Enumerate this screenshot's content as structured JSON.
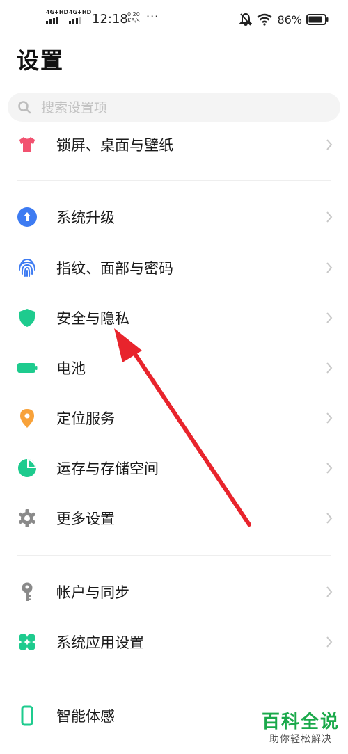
{
  "status_bar": {
    "sim1": "4G+HD",
    "sim2": "4G+HD",
    "time": "12:18",
    "speed_value": "0.20",
    "speed_unit": "KB/s",
    "more": "···",
    "battery": "86%",
    "battery_level": 0.86,
    "icons": [
      "signal-icon",
      "signal-icon",
      "mute-bell-icon",
      "wifi-icon",
      "battery-icon"
    ]
  },
  "header": {
    "title": "设置"
  },
  "search": {
    "placeholder": "搜索设置项",
    "value": ""
  },
  "groups": [
    {
      "items": [
        {
          "label": "锁屏、桌面与壁纸",
          "icon": "tshirt-icon",
          "color": "#f25270"
        }
      ]
    },
    {
      "items": [
        {
          "label": "系统升级",
          "icon": "upgrade-arrow-icon",
          "color": "#3d7bf2"
        },
        {
          "label": "指纹、面部与密码",
          "icon": "fingerprint-icon",
          "color": "#3d7bf2"
        },
        {
          "label": "安全与隐私",
          "icon": "shield-icon",
          "color": "#1ecb8e"
        },
        {
          "label": "电池",
          "icon": "battery-icon",
          "color": "#1ecb8e"
        },
        {
          "label": "定位服务",
          "icon": "location-pin-icon",
          "color": "#f8a23a"
        },
        {
          "label": "运存与存储空间",
          "icon": "pie-chart-icon",
          "color": "#1ecb8e"
        },
        {
          "label": "更多设置",
          "icon": "gear-icon",
          "color": "#8a8a8a"
        }
      ]
    },
    {
      "items": [
        {
          "label": "帐户与同步",
          "icon": "key-icon",
          "color": "#8a8a8a"
        },
        {
          "label": "系统应用设置",
          "icon": "apps-grid-icon",
          "color": "#1ecb8e"
        }
      ]
    },
    {
      "items": [
        {
          "label": "智能体感",
          "icon": "phone-outline-icon",
          "color": "#1ecb8e"
        }
      ]
    }
  ],
  "watermark": {
    "title": "百科全说",
    "subtitle": "助你轻松解决",
    "color": "#1aa94a"
  },
  "annotation": {
    "arrow_color": "#e8242c",
    "points_to": "安全与隐私"
  }
}
